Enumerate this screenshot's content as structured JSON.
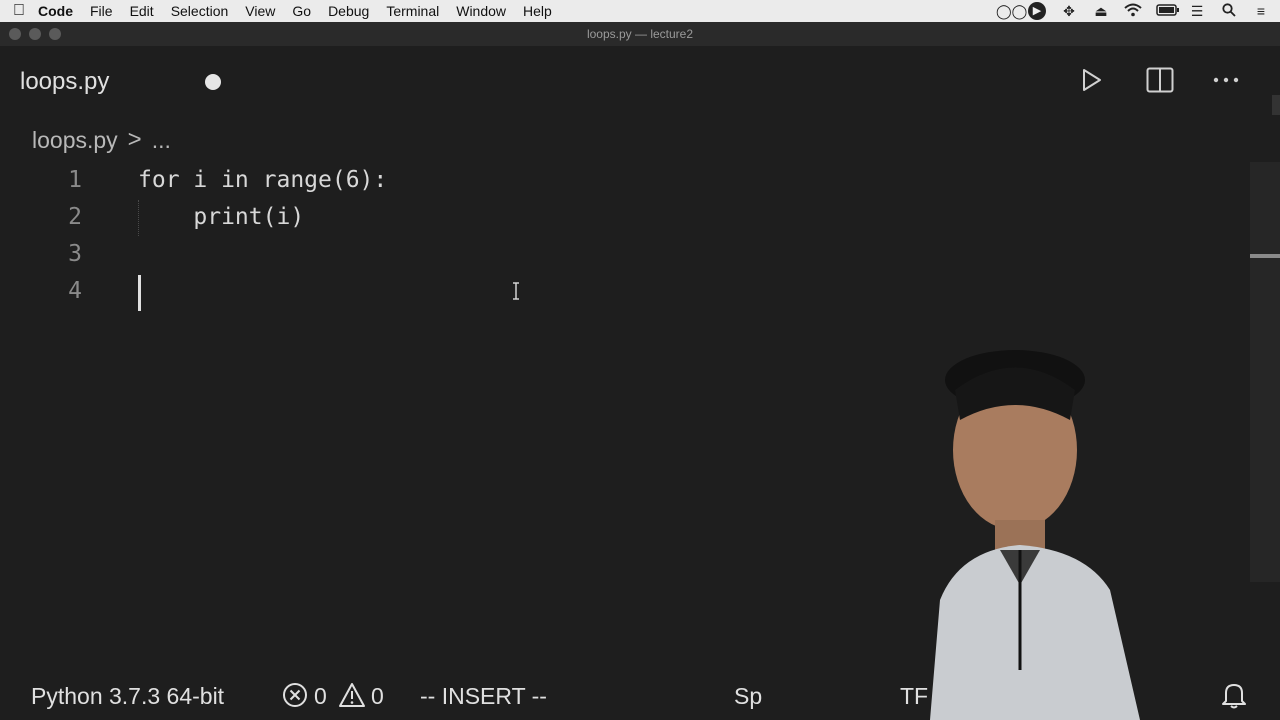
{
  "menubar": {
    "apple_icon": "apple-icon",
    "items": [
      "Code",
      "File",
      "Edit",
      "Selection",
      "View",
      "Go",
      "Debug",
      "Terminal",
      "Window",
      "Help"
    ],
    "tray_icons": [
      "glasses-icon",
      "play-circle-icon",
      "move-icon",
      "eject-icon",
      "wifi-icon",
      "battery-icon",
      "sliders-icon",
      "search-icon",
      "list-icon"
    ]
  },
  "window": {
    "title": "loops.py — lecture2"
  },
  "tab": {
    "label": "loops.py",
    "dirty": true
  },
  "actions": {
    "run_icon": "play-icon",
    "split_icon": "split-editor-icon",
    "more_icon": "more-icon"
  },
  "breadcrumb": {
    "file": "loops.py",
    "separator": ">",
    "rest": "..."
  },
  "editor": {
    "lines": [
      {
        "number": "1",
        "text": "for i in range(6):"
      },
      {
        "number": "2",
        "text": "    print(i)"
      },
      {
        "number": "3",
        "text": ""
      },
      {
        "number": "4",
        "text": ""
      }
    ],
    "cursor_line": 4
  },
  "statusbar": {
    "interpreter": "Python 3.7.3 64-bit",
    "errors": "0",
    "warnings": "0",
    "mode": "-- INSERT --",
    "spaces_partial": "Sp",
    "encoding_partial": "TF",
    "bell_icon": "bell-icon"
  },
  "colors": {
    "background": "#1e1e1e",
    "menubar": "#ebebeb",
    "text": "#d4d4d4"
  }
}
